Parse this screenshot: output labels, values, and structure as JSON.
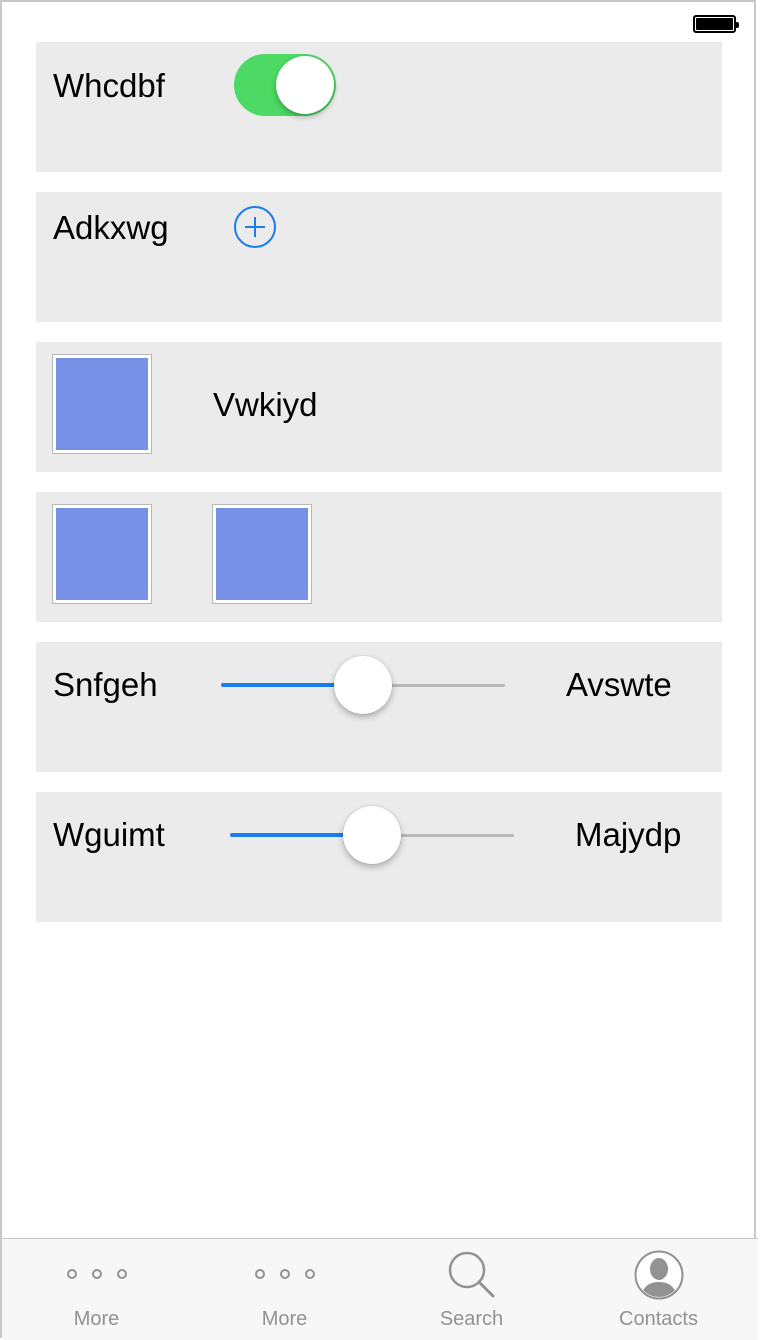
{
  "status_bar": {
    "battery_icon": "battery-full-icon"
  },
  "rows": [
    {
      "label": "Whcdbf",
      "control": "toggle",
      "on": true,
      "accent": "#4cd964"
    },
    {
      "label": "Adkxwg",
      "control": "add-button",
      "accent": "#1a7cf0"
    },
    {
      "label": "Vwkiyd",
      "control": "image"
    },
    {
      "control": "images",
      "count": 2
    },
    {
      "label": "Snfgeh",
      "right_label": "Avswte",
      "control": "slider",
      "value": 0.5
    },
    {
      "label": "Wguimt",
      "right_label": "Majydp",
      "control": "slider",
      "value": 0.5
    }
  ],
  "tabbar": {
    "tabs": [
      {
        "label": "More",
        "icon": "more-icon"
      },
      {
        "label": "More",
        "icon": "more-icon"
      },
      {
        "label": "Search",
        "icon": "search-icon"
      },
      {
        "label": "Contacts",
        "icon": "contacts-icon"
      }
    ]
  },
  "colors": {
    "row_background": "#ebebeb",
    "toggle_on": "#4cd964",
    "accent_blue": "#1a7cf0",
    "image_fill": "#7690e6",
    "tab_inactive": "#929292"
  }
}
